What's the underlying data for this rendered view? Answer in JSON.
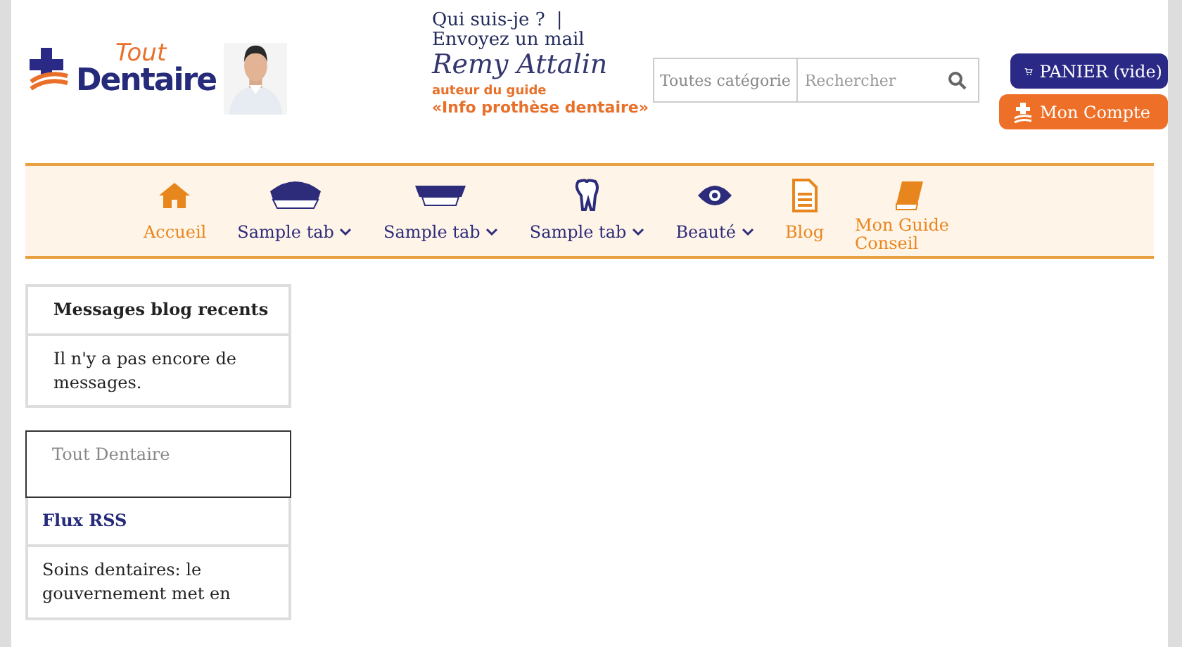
{
  "logo": {
    "top": "Tout",
    "bottom": "Dentaire"
  },
  "author": {
    "links": [
      "Qui suis-je ?",
      "|",
      "Envoyez un mail"
    ],
    "signature": "Remy Attalin",
    "role": "auteur du guide",
    "guide": "«Info prothèse dentaire»"
  },
  "search": {
    "category": "Toutes catégorie",
    "placeholder": "Rechercher"
  },
  "cart": {
    "label": "PANIER (vide)"
  },
  "account": {
    "label": "Mon Compte"
  },
  "nav": [
    {
      "kind": "home",
      "label": "Accueil",
      "dropdown": false,
      "accent": true
    },
    {
      "kind": "teeth",
      "label": "Sample tab",
      "dropdown": true,
      "accent": false
    },
    {
      "kind": "braces",
      "label": "Sample tab",
      "dropdown": true,
      "accent": false
    },
    {
      "kind": "tooth",
      "label": "Sample tab",
      "dropdown": true,
      "accent": false
    },
    {
      "kind": "eye",
      "label": "Beauté",
      "dropdown": true,
      "accent": false
    },
    {
      "kind": "doc",
      "label": "Blog",
      "dropdown": false,
      "accent": true
    },
    {
      "kind": "book",
      "label": "Mon Guide Conseil",
      "dropdown": false,
      "accent": true
    }
  ],
  "sidebar": [
    {
      "kind": "heading",
      "text": "Messages blog recents"
    },
    {
      "kind": "text",
      "text": "Il n'y a pas encore de messages."
    },
    {
      "kind": "input",
      "text": "Tout Dentaire"
    },
    {
      "kind": "link",
      "text": "Flux RSS"
    },
    {
      "kind": "text",
      "text": "Soins dentaires: le gouvernement met en"
    }
  ]
}
